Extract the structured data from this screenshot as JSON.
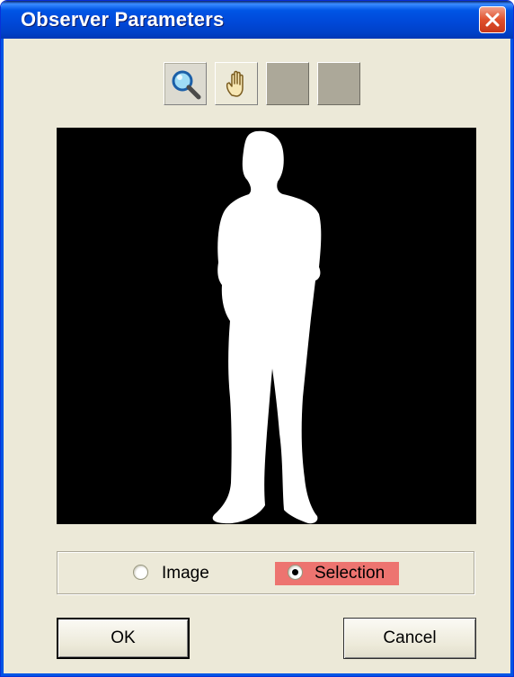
{
  "window": {
    "title": "Observer Parameters"
  },
  "toolbar": {
    "tools": [
      {
        "icon": "magnifier-icon",
        "state": "pressed"
      },
      {
        "icon": "hand-icon",
        "state": "raised"
      },
      {
        "icon": "blank",
        "state": "disabled"
      },
      {
        "icon": "blank",
        "state": "disabled"
      }
    ]
  },
  "view_mode": {
    "options": [
      {
        "label": "Image",
        "selected": false
      },
      {
        "label": "Selection",
        "selected": true
      }
    ],
    "highlight_color": "#ed7470"
  },
  "buttons": {
    "ok_label": "OK",
    "cancel_label": "Cancel"
  }
}
